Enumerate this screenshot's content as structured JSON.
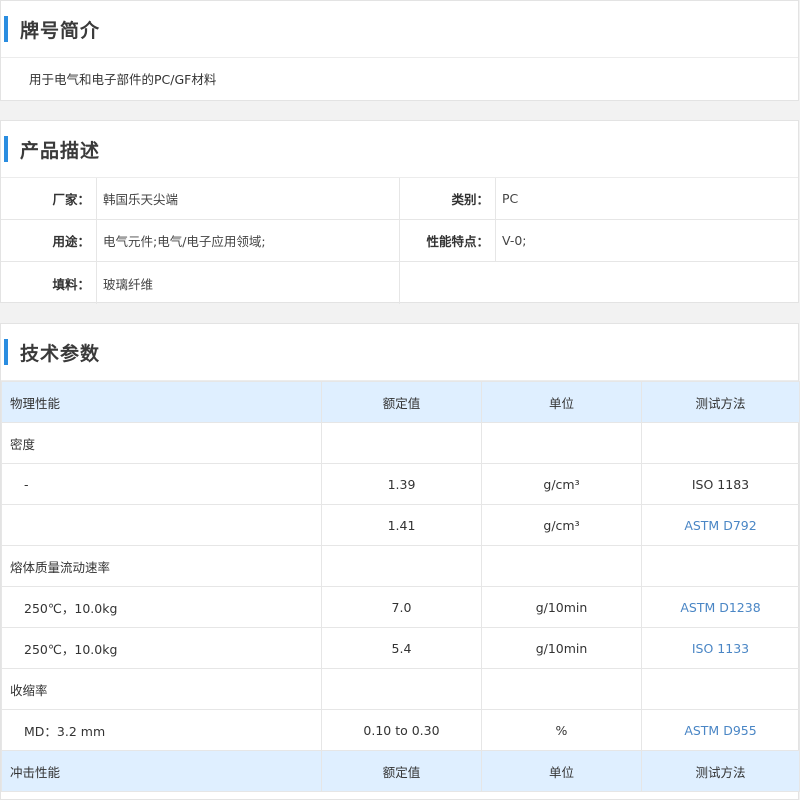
{
  "intro": {
    "title": "牌号简介",
    "text": "用于电气和电子部件的PC/GF材料"
  },
  "description": {
    "title": "产品描述",
    "rows": [
      {
        "k1": "厂家：",
        "v1": "韩国乐天尖端",
        "k2": "类别：",
        "v2": "PC"
      },
      {
        "k1": "用途：",
        "v1": "电气元件;电气/电子应用领域;",
        "k2": "性能特点：",
        "v2": "V-0;"
      },
      {
        "k1": "填料：",
        "v1": "玻璃纤维"
      }
    ]
  },
  "tech": {
    "title": "技术参数",
    "header": {
      "name": "物理性能",
      "value": "额定值",
      "unit": "单位",
      "method": "测试方法"
    },
    "rows": [
      {
        "name": "密度",
        "value": "",
        "unit": "",
        "method": "",
        "sub": false,
        "link": false
      },
      {
        "name": "-",
        "value": "1.39",
        "unit": "g/cm³",
        "method": "ISO 1183",
        "sub": true,
        "link": false
      },
      {
        "name": "",
        "value": "1.41",
        "unit": "g/cm³",
        "method": "ASTM D792",
        "sub": true,
        "link": true
      },
      {
        "name": "熔体质量流动速率",
        "value": "",
        "unit": "",
        "method": "",
        "sub": false,
        "link": false
      },
      {
        "name": "250℃，10.0kg",
        "value": "7.0",
        "unit": "g/10min",
        "method": "ASTM D1238",
        "sub": true,
        "link": true
      },
      {
        "name": "250℃，10.0kg",
        "value": "5.4",
        "unit": "g/10min",
        "method": "ISO 1133",
        "sub": true,
        "link": true
      },
      {
        "name": "收缩率",
        "value": "",
        "unit": "",
        "method": "",
        "sub": false,
        "link": false
      },
      {
        "name": "MD：3.2 mm",
        "value": "0.10 to 0.30",
        "unit": "%",
        "method": "ASTM D955",
        "sub": true,
        "link": true
      }
    ],
    "header2": {
      "name": "冲击性能",
      "value": "额定值",
      "unit": "单位",
      "method": "测试方法"
    }
  }
}
